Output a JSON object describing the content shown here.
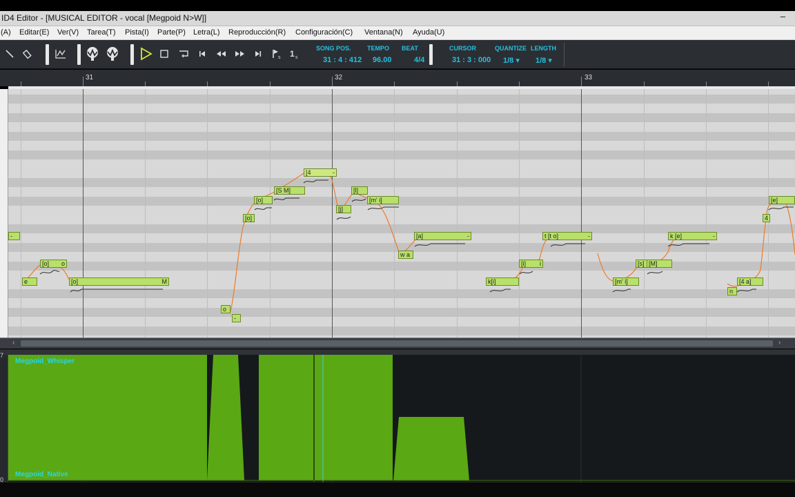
{
  "window": {
    "title": "ID4 Editor - [MUSICAL EDITOR - vocal [Megpoid N>W]]",
    "minimize": "–"
  },
  "menu": [
    {
      "label": "(A)"
    },
    {
      "label": "Editar(E)"
    },
    {
      "label": "Ver(V)"
    },
    {
      "label": "Tarea(T)"
    },
    {
      "label": "Pista(I)"
    },
    {
      "label": "Parte(P)"
    },
    {
      "label": "Letra(L)"
    },
    {
      "label": "Reproducción(R)"
    },
    {
      "label": "Configuración(C)"
    },
    {
      "label": "Ventana(N)"
    },
    {
      "label": "Ayuda(U)"
    }
  ],
  "toolbar": {
    "song_pos_label": "SONG POS.",
    "song_pos_value": "31 : 4 : 412",
    "tempo_label": "TEMPO",
    "tempo_value": "96.00",
    "beat_label": "BEAT",
    "beat_value": "4/4",
    "cursor_label": "CURSOR",
    "cursor_value": "31 : 3 : 000",
    "quantize_label": "QUANTIZE",
    "quantize_value": "1/8 ▾",
    "length_label": "LENGTH",
    "length_value": "1/8 ▾",
    "accent_color": "#27bfe0",
    "tools": [
      "pencil-icon",
      "eraser-icon",
      "curve-edit-icon",
      "vocal-tree-icon",
      "vocal-tree-icon",
      "play-icon",
      "stop-icon",
      "loop-icon",
      "go-start-icon",
      "rewind-icon",
      "fast-forward-icon",
      "go-end-icon",
      "flag-marker-icon",
      "punch-icon"
    ]
  },
  "ruler": {
    "bars": [
      "31",
      "32",
      "33"
    ]
  },
  "notes": {
    "n_edge": "-",
    "n_e": "e",
    "n_o1": "[o]",
    "n_o1_tail": "o",
    "n_o2": "[o]",
    "n_o2_tail": "M",
    "n_o3": "o",
    "n_dash1": "-",
    "n_o4": "[o]",
    "n_o5": "[o]",
    "n_sm": "[S M]",
    "n_4": "[4",
    "n_4_tail": "-",
    "n_j": "[j]",
    "n_l": "[l]",
    "n_mi": "[m' i]",
    "n_wa": "w a",
    "n_a": "[a]",
    "n_a_tail": "-",
    "n_kii": "k[i]",
    "n_i": "[i]",
    "n_i_tail": "i",
    "n_to": "t [t o]",
    "n_to_tail": "-",
    "n_mi2": "[m' i]",
    "n_sm2": "[s]",
    "n_m": "[M]",
    "n_ke": "k [e]",
    "n_ke_tail": "-",
    "n_n": "n",
    "n_4a": "[4 a]",
    "n_4b": "4",
    "n_e2": "[e]"
  },
  "lanes": {
    "top_label": "Megpoid_Whisper",
    "bottom_label": "Megpoid_Native",
    "lane_color": "#5aa814",
    "label_color": "#27d6e6",
    "side_top": "7",
    "side_bottom": "0"
  }
}
